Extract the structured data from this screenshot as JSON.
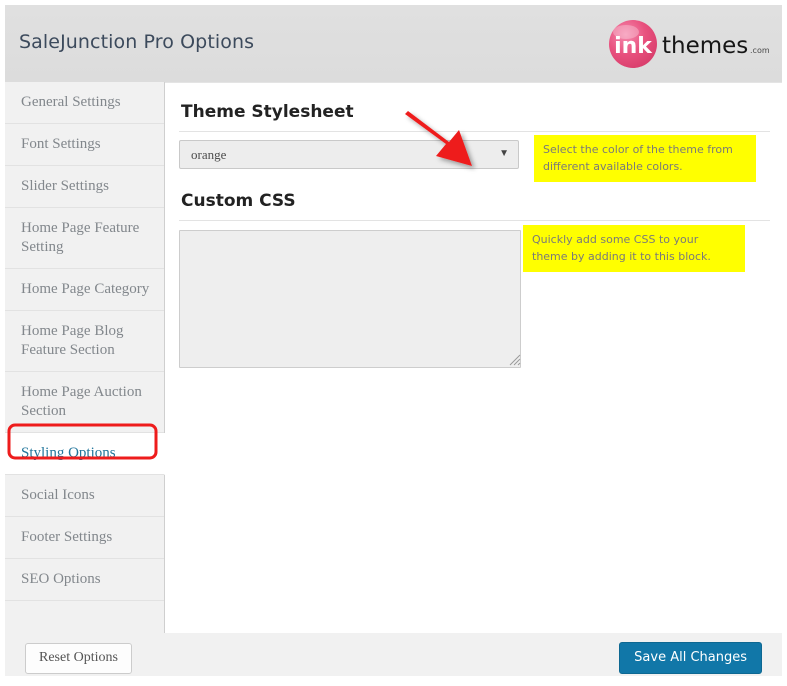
{
  "header": {
    "title": "SaleJunction Pro Options",
    "logo": {
      "mark_text": "ink",
      "word_text": "themes",
      "suffix_text": ".com",
      "circle_color": "#e8517e",
      "word_color": "#1a1a1a"
    }
  },
  "sidebar": {
    "items": [
      {
        "label": "General Settings",
        "active": false
      },
      {
        "label": "Font Settings",
        "active": false
      },
      {
        "label": "Slider Settings",
        "active": false
      },
      {
        "label": "Home Page Feature Setting",
        "active": false
      },
      {
        "label": "Home Page Category",
        "active": false
      },
      {
        "label": "Home Page Blog Feature Section",
        "active": false
      },
      {
        "label": "Home Page Auction Section",
        "active": false
      },
      {
        "label": "Styling Options",
        "active": true
      },
      {
        "label": "Social Icons",
        "active": false
      },
      {
        "label": "Footer Settings",
        "active": false
      },
      {
        "label": "SEO Options",
        "active": false
      }
    ],
    "active_color": "#21759b",
    "inactive_color": "#82878c"
  },
  "content": {
    "theme_stylesheet": {
      "heading": "Theme Stylesheet",
      "select_value": "orange",
      "select_caret": "▼",
      "tooltip": "Select the color of the theme from different available colors."
    },
    "custom_css": {
      "heading": "Custom CSS",
      "textarea_value": "",
      "textarea_placeholder": "",
      "tooltip": "Quickly add some CSS to your theme by adding it to this block."
    }
  },
  "footer": {
    "reset_label": "Reset Options",
    "save_label": "Save All Changes",
    "save_color": "#1177a8"
  },
  "annotations": {
    "arrow_color": "#ee1c1c",
    "highlight_box_color": "#ee1c1c",
    "tooltip_background": "#ffff00"
  }
}
